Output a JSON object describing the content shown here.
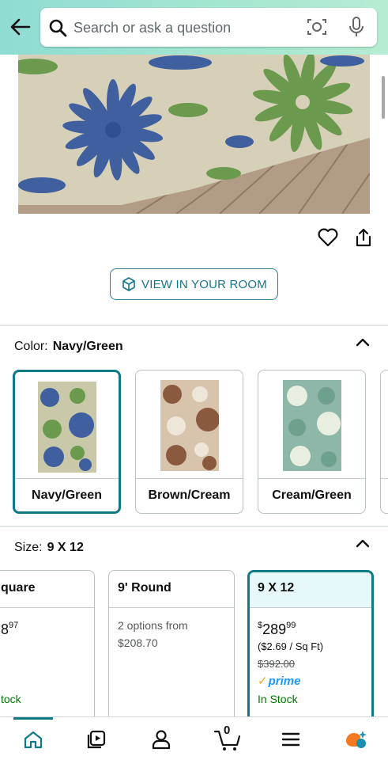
{
  "search": {
    "placeholder": "Search or ask a question"
  },
  "view_in_room": {
    "label": "VIEW IN YOUR ROOM"
  },
  "color_row": {
    "label": "Color:",
    "value": "Navy/Green"
  },
  "color_options": [
    {
      "label": "Navy/Green",
      "selected": true
    },
    {
      "label": "Brown/Cream",
      "selected": false
    },
    {
      "label": "Cream/Green",
      "selected": false
    }
  ],
  "size_row": {
    "label": "Size:",
    "value": "9 X 12"
  },
  "size_options": [
    {
      "title": "quare",
      "price_whole": "8",
      "price_frac": "97",
      "stock": "tock"
    },
    {
      "title": "9' Round",
      "options_text": "2 options from",
      "options_price": "$208.70"
    },
    {
      "title": "9 X 12",
      "price_symbol": "$",
      "price_whole": "289",
      "price_frac": "99",
      "unit_price": "($2.69 / Sq Ft)",
      "list_price": "$392.00",
      "prime": "prime",
      "stock": "In Stock",
      "selected": true
    }
  ],
  "cart": {
    "count": "0"
  },
  "colors": {
    "accent": "#0f7a86",
    "link": "#16758c",
    "in_stock": "#007600",
    "prime": "#1a98ff",
    "header_gradient_start": "#8fdcd3"
  }
}
